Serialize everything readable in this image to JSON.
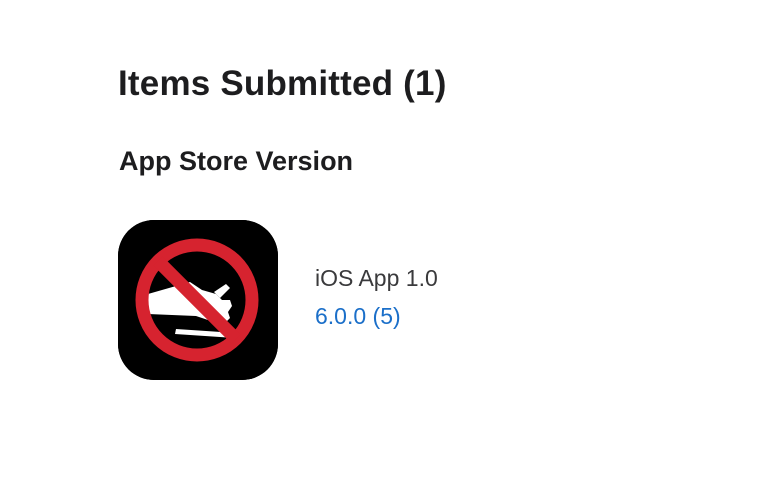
{
  "page": {
    "title": "Items Submitted (1)"
  },
  "section": {
    "title": "App Store Version"
  },
  "items": [
    {
      "icon": "no-touching-hand-icon",
      "name": "iOS App 1.0",
      "version": "6.0.0 (5)"
    }
  ],
  "colors": {
    "text_primary": "#1d1d1f",
    "text_secondary": "#3a3a3c",
    "link": "#1b6fc9",
    "icon_background": "#000000",
    "prohibition_red": "#d6232f"
  }
}
